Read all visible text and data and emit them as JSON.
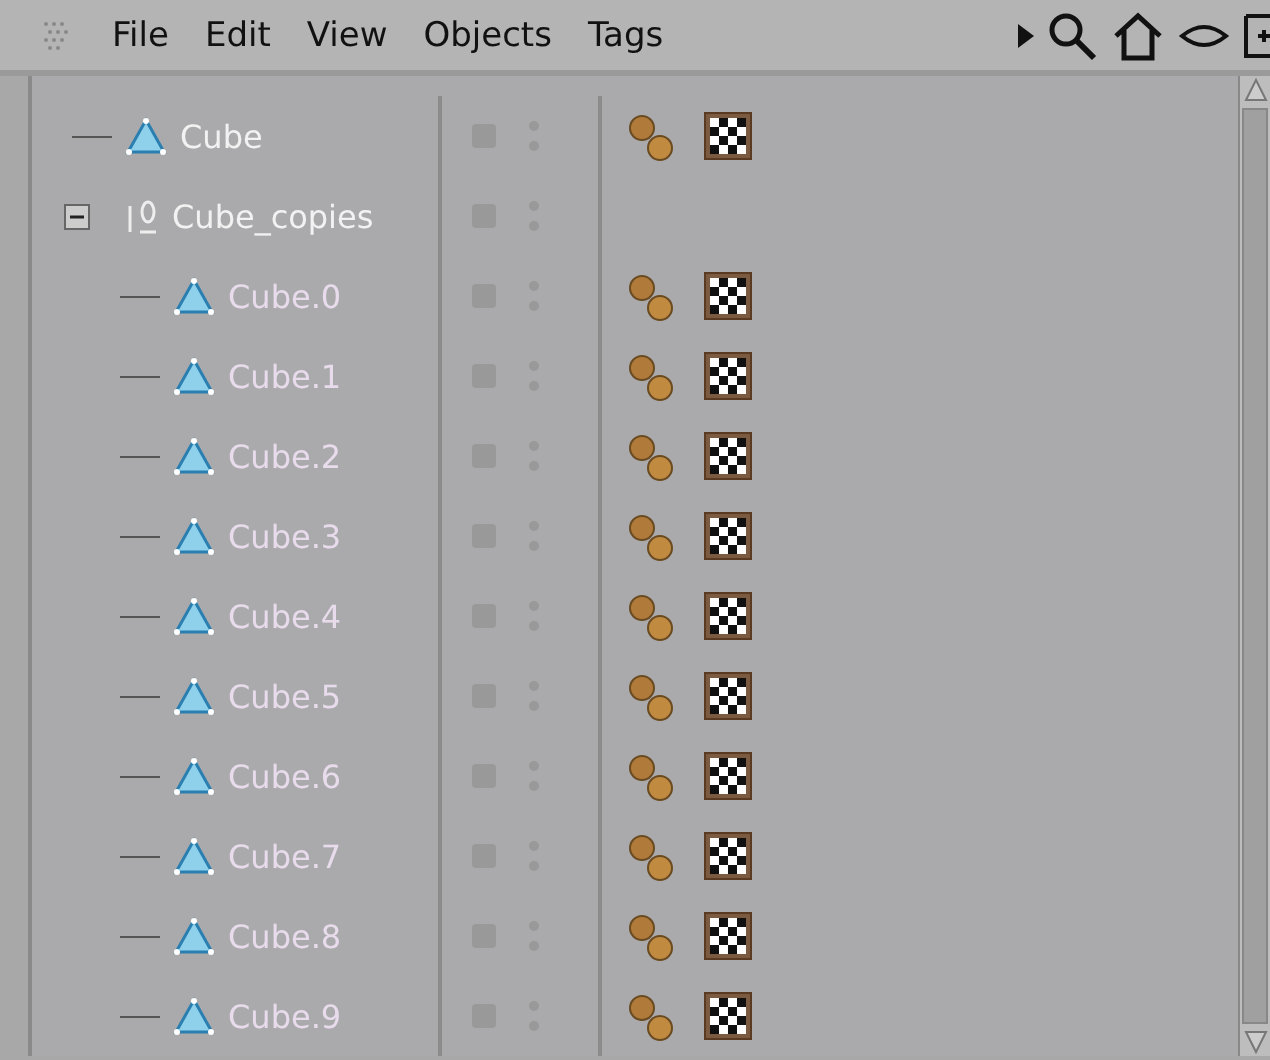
{
  "menu": [
    "File",
    "Edit",
    "View",
    "Objects",
    "Tags"
  ],
  "objects": [
    {
      "name": "Cube",
      "kind": "polygon",
      "tags": [
        {
          "kind": "spheres"
        },
        {
          "kind": "checker"
        }
      ]
    },
    {
      "name": "Cube_copies",
      "kind": "null",
      "expanded": true,
      "children": [
        {
          "name": "Cube.0",
          "kind": "polygon",
          "tags": [
            {
              "kind": "spheres"
            },
            {
              "kind": "checker"
            }
          ]
        },
        {
          "name": "Cube.1",
          "kind": "polygon",
          "tags": [
            {
              "kind": "spheres"
            },
            {
              "kind": "checker"
            }
          ]
        },
        {
          "name": "Cube.2",
          "kind": "polygon",
          "tags": [
            {
              "kind": "spheres"
            },
            {
              "kind": "checker"
            }
          ]
        },
        {
          "name": "Cube.3",
          "kind": "polygon",
          "tags": [
            {
              "kind": "spheres"
            },
            {
              "kind": "checker"
            }
          ]
        },
        {
          "name": "Cube.4",
          "kind": "polygon",
          "tags": [
            {
              "kind": "spheres"
            },
            {
              "kind": "checker"
            }
          ]
        },
        {
          "name": "Cube.5",
          "kind": "polygon",
          "tags": [
            {
              "kind": "spheres"
            },
            {
              "kind": "checker"
            }
          ]
        },
        {
          "name": "Cube.6",
          "kind": "polygon",
          "tags": [
            {
              "kind": "spheres"
            },
            {
              "kind": "checker"
            }
          ]
        },
        {
          "name": "Cube.7",
          "kind": "polygon",
          "tags": [
            {
              "kind": "spheres"
            },
            {
              "kind": "checker"
            }
          ]
        },
        {
          "name": "Cube.8",
          "kind": "polygon",
          "tags": [
            {
              "kind": "spheres"
            },
            {
              "kind": "checker"
            }
          ]
        },
        {
          "name": "Cube.9",
          "kind": "polygon",
          "tags": [
            {
              "kind": "spheres"
            },
            {
              "kind": "checker"
            }
          ]
        }
      ]
    }
  ]
}
